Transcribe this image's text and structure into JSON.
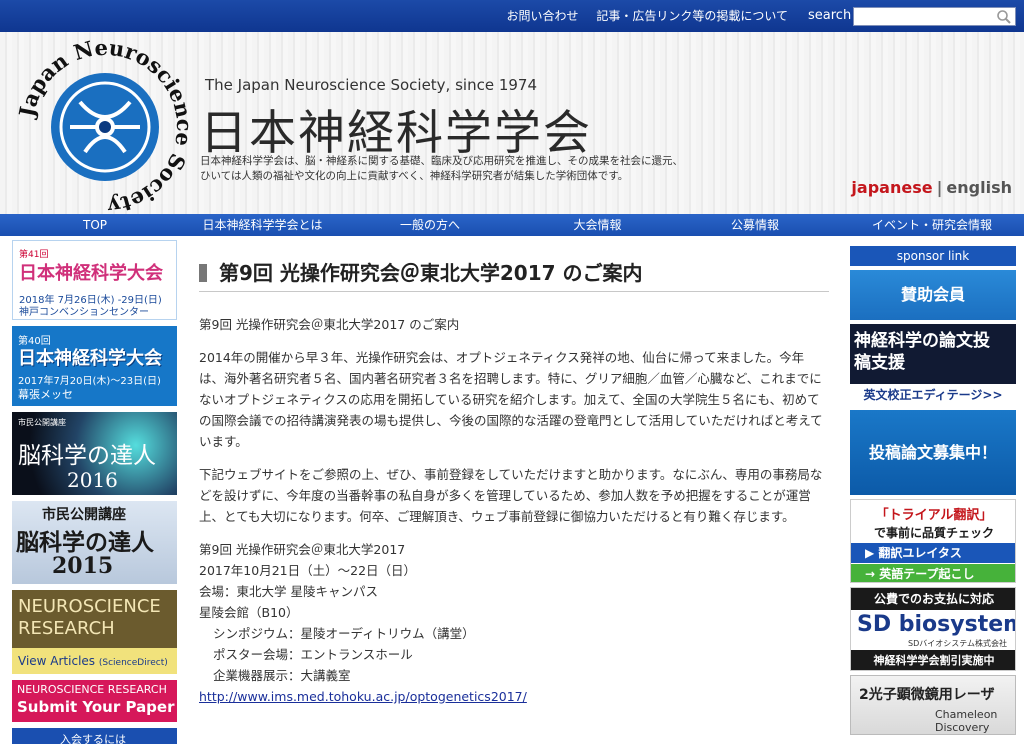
{
  "topbar": {
    "contact": "お問い合わせ",
    "policy": "記事・広告リンク等の掲載について",
    "search_label": "search",
    "search_placeholder": ""
  },
  "header": {
    "logo_text": "Japan Neuroscience Society",
    "tagline": "The Japan Neuroscience Society, since 1974",
    "title": "日本神経科学学会",
    "desc_line1": "日本神経科学学会は、脳・神経系に関する基礎、臨床及び応用研究を推進し、その成果を社会に還元、",
    "desc_line2": "ひいては人類の福祉や文化の向上に貢献すべく、神経科学研究者が結集した学術団体です。",
    "lang_jp": "japanese",
    "lang_sep": "|",
    "lang_en": "english"
  },
  "nav": [
    {
      "label": "TOP"
    },
    {
      "label": "日本神経科学学会とは"
    },
    {
      "label": "一般の方へ"
    },
    {
      "label": "大会情報"
    },
    {
      "label": "公募情報"
    },
    {
      "label": "イベント・研究会情報"
    }
  ],
  "left_banners": {
    "b1": {
      "t1": "第41回",
      "t2": "日本神経科学大会",
      "t3": "2018年 7月26日(木) -29日(日)",
      "t4": "神戸コンベンションセンター"
    },
    "b2": {
      "t1": "第40回",
      "t2": "日本神経科学大会",
      "t3": "2017年7月20日(木)～23日(日)",
      "t4": "幕張メッセ"
    },
    "b3": {
      "t1": "市民公開講座",
      "t2": "脳科学の達人",
      "t3": "2016"
    },
    "b4": {
      "t1": "市民公開講座",
      "t2": "脳科学の達人",
      "t3": "2015"
    },
    "b5": {
      "t1": "NEUROSCIENCE RESEARCH",
      "t2": "View Articles",
      "t2b": "(ScienceDirect)"
    },
    "b6": {
      "t1": "NEUROSCIENCE RESEARCH",
      "t2": "Submit Your Paper !"
    },
    "b7": {
      "t1": "入会するには"
    }
  },
  "content": {
    "title": "第9回 光操作研究会＠東北大学2017 のご案内",
    "intro": "第9回 光操作研究会＠東北大学2017 のご案内",
    "para1": "2014年の開催から早３年、光操作研究会は、オプトジェネティクス発祥の地、仙台に帰って来ました。今年は、海外著名研究者５名、国内著名研究者３名を招聘します。特に、グリア細胞／血管／心臓など、これまでにないオプトジェネティクスの応用を開拓している研究を紹介します。加えて、全国の大学院生５名にも、初めての国際会議での招待講演発表の場も提供し、今後の国際的な活躍の登竜門として活用していただければと考えています。",
    "para2": "下記ウェブサイトをご参照の上、ぜひ、事前登録をしていただけますと助かります。なにぶん、専用の事務局などを設けずに、今年度の当番幹事の私自身が多くを管理しているため、参加人数を予め把握をすることが運営上、とても大切になります。何卒、ご理解頂き、ウェブ事前登録に御協力いただけると有り難く存じます。",
    "details": {
      "name": "第9回 光操作研究会＠東北大学2017",
      "date": "2017年10月21日（土）～22日（日）",
      "venue": "会場：東北大学 星陵キャンパス",
      "hall": "星陵会館（B10）",
      "symposium": "シンポジウム：星陵オーディトリウム（講堂）",
      "poster": "ポスター会場：エントランスホール",
      "exhibit": "企業機器展示：大講義室",
      "url": "http://www.ims.med.tohoku.ac.jp/optogenetics2017/"
    }
  },
  "right": {
    "sponsor_label": "sponsor link",
    "r1": "賛助会員",
    "r2": {
      "t1": "神経科学の論文投稿支援",
      "t2": "英文校正エディテージ>>"
    },
    "r3": "投稿論文募集中！",
    "r4": {
      "t1": "「トライアル翻訳」",
      "t2": "で事前に品質チェック",
      "t3": "翻訳ユレイタス",
      "t4": "英語テープ起こし"
    },
    "r5": {
      "t1": "公費でのお支払に対応",
      "t2": "SD biosystem",
      "t3": "SDバイオシステム株式会社",
      "t4": "神経科学学会割引実施中"
    },
    "r6": {
      "t1": "2光子顕微鏡用レーザ",
      "t2": "Chameleon Discovery"
    }
  },
  "colors": {
    "topbar": "#1c4aa8",
    "nav": "#1a4fb0",
    "lang_accent": "#c4161c",
    "link": "#1a2f9a"
  }
}
